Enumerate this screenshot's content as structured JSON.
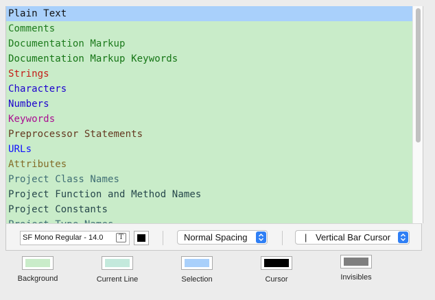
{
  "items": [
    {
      "label": "Plain Text",
      "color": "#111111"
    },
    {
      "label": "Comments",
      "color": "#1c7a1c"
    },
    {
      "label": "Documentation Markup",
      "color": "#1c7a1c"
    },
    {
      "label": "Documentation Markup Keywords",
      "color": "#157515"
    },
    {
      "label": "Strings",
      "color": "#c41a16"
    },
    {
      "label": "Characters",
      "color": "#1c00cf"
    },
    {
      "label": "Numbers",
      "color": "#1c00cf"
    },
    {
      "label": "Keywords",
      "color": "#aa0d91"
    },
    {
      "label": "Preprocessor Statements",
      "color": "#643820"
    },
    {
      "label": "URLs",
      "color": "#0e0eff"
    },
    {
      "label": "Attributes",
      "color": "#836c28"
    },
    {
      "label": "Project Class Names",
      "color": "#3f6e74"
    },
    {
      "label": "Project Function and Method Names",
      "color": "#26474b"
    },
    {
      "label": "Project Constants",
      "color": "#26474b"
    },
    {
      "label": "Project Type Names",
      "color": "#3f6e74"
    }
  ],
  "selected_index": 0,
  "font": {
    "value": "SF Mono Regular - 14.0",
    "button_glyph": "T",
    "color": "#000000"
  },
  "spacing": {
    "value": "Normal Spacing"
  },
  "cursor": {
    "prefix": "|",
    "value": "Vertical Bar Cursor"
  },
  "wells": [
    {
      "label": "Background",
      "color": "#c9ecc9"
    },
    {
      "label": "Current Line",
      "color": "#c3e9dc"
    },
    {
      "label": "Selection",
      "color": "#a9d0fb"
    },
    {
      "label": "Cursor",
      "color": "#000000"
    },
    {
      "label": "Invisibles",
      "color": "#7f7f7f"
    }
  ]
}
